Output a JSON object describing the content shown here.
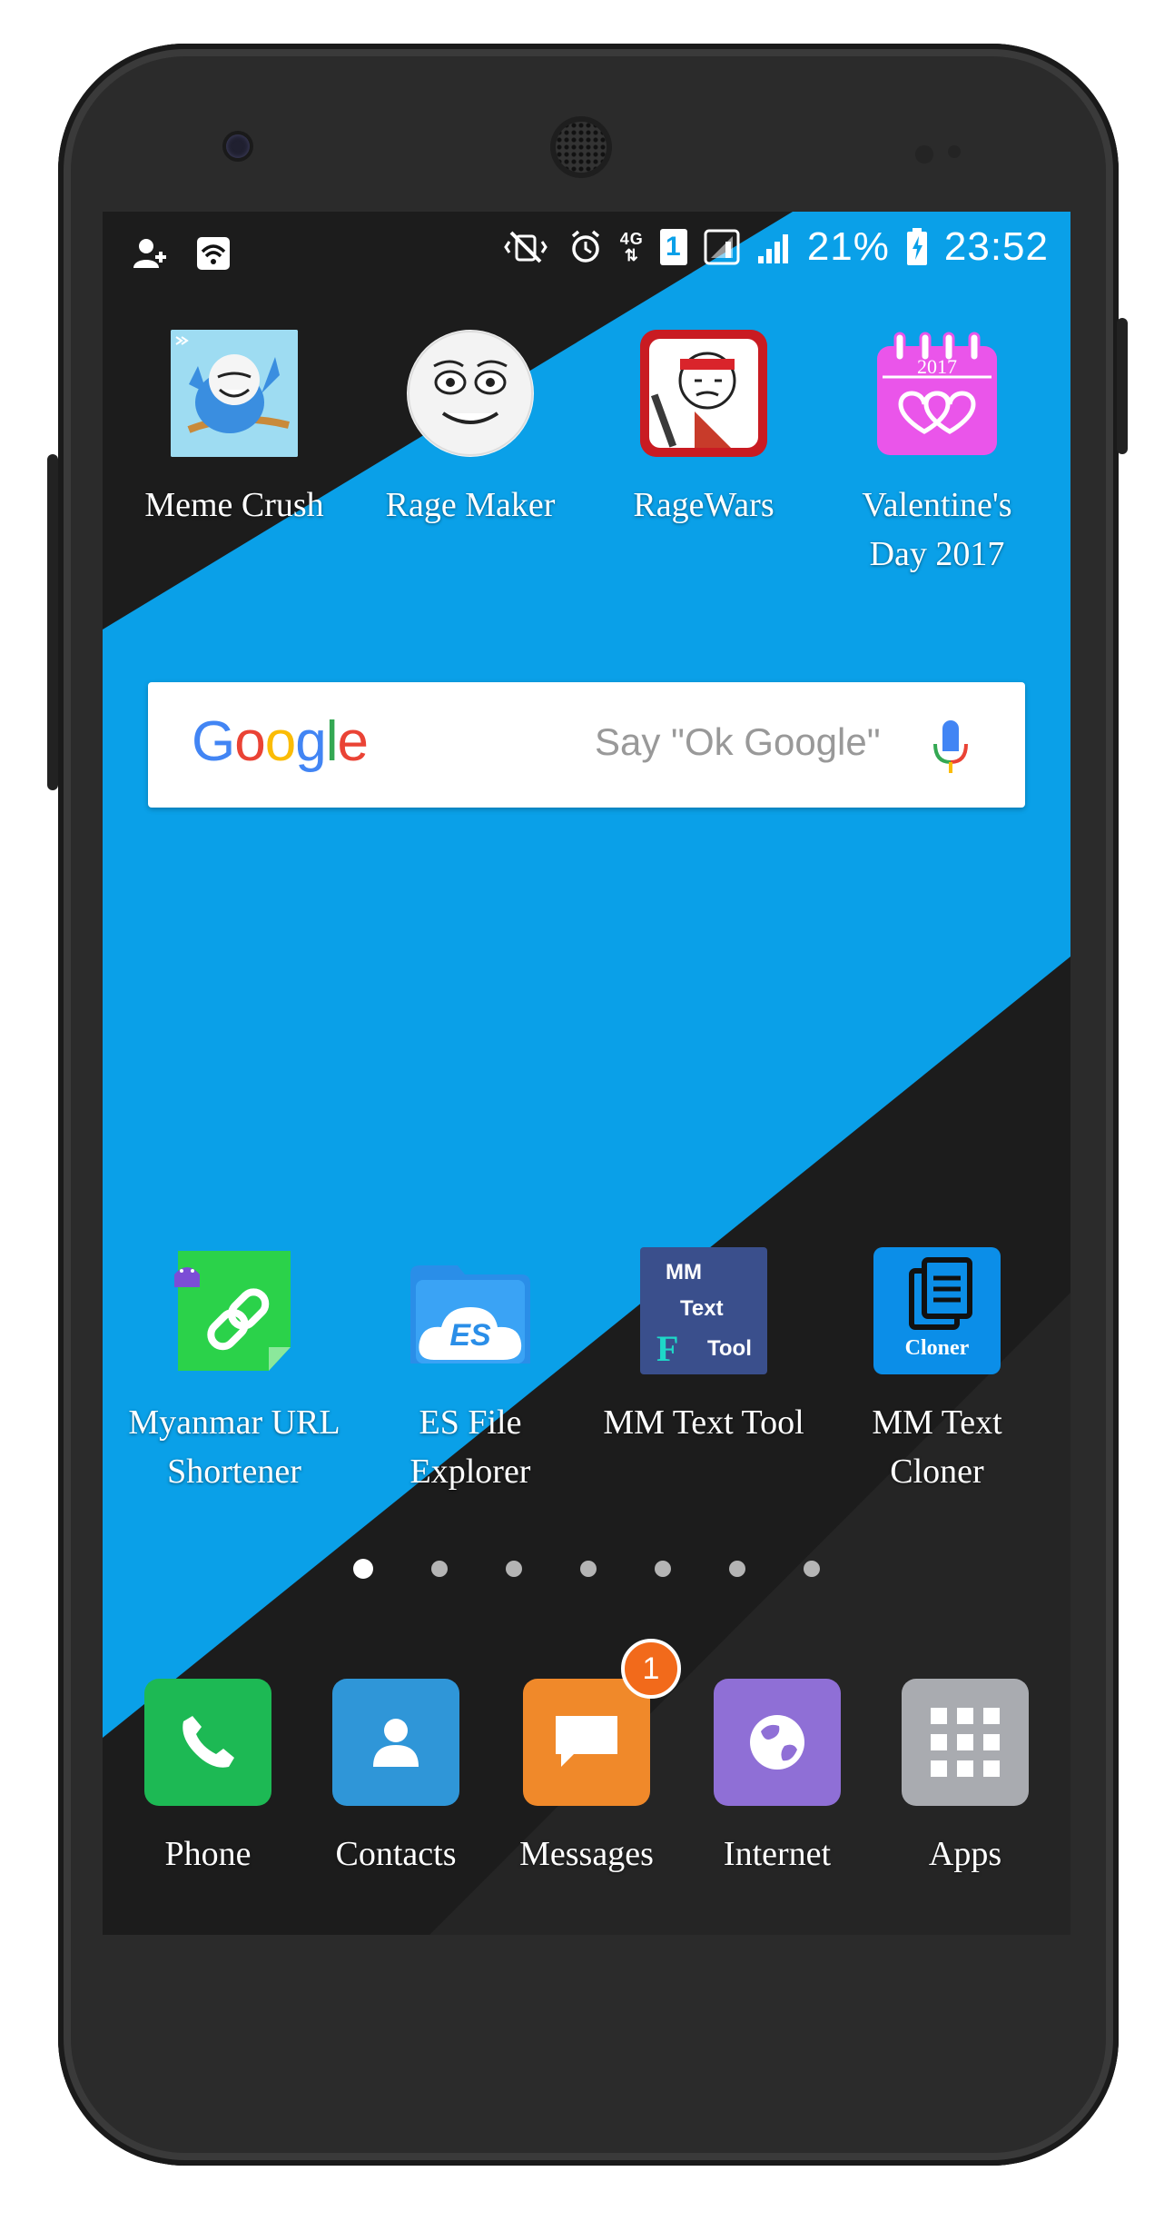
{
  "status_bar": {
    "battery": "21%",
    "time": "23:52",
    "network": "4G",
    "sim": "1"
  },
  "home_apps": [
    {
      "label": "Meme Crush",
      "icon": "meme-crush-icon"
    },
    {
      "label": "Rage Maker",
      "icon": "rage-maker-icon"
    },
    {
      "label": "RageWars",
      "icon": "ragewars-icon"
    },
    {
      "label": "Valentine's\nDay 2017",
      "icon": "valentine-calendar-icon",
      "year": "2017"
    },
    {
      "label": "Myanmar URL\nShortener",
      "icon": "link-icon"
    },
    {
      "label": "ES File\nExplorer",
      "icon": "es-cloud-icon",
      "glyph": "ES"
    },
    {
      "label": "MM Text Tool",
      "icon": "mm-text-tool-icon",
      "lines": [
        "MM",
        "Text",
        "F",
        "Tool"
      ]
    },
    {
      "label": "MM Text\nCloner",
      "icon": "document-copy-icon",
      "caption": "Cloner"
    }
  ],
  "google_bar": {
    "logo": "Google",
    "hint": "Say \"Ok Google\""
  },
  "pages": {
    "count": 7,
    "active": 0
  },
  "dock": [
    {
      "label": "Phone",
      "icon": "phone-icon",
      "color": "#1db954"
    },
    {
      "label": "Contacts",
      "icon": "contact-icon",
      "color": "#2f96d8"
    },
    {
      "label": "Messages",
      "icon": "message-icon",
      "color": "#f0892a",
      "badge": "1"
    },
    {
      "label": "Internet",
      "icon": "globe-icon",
      "color": "#8f6fd6"
    },
    {
      "label": "Apps",
      "icon": "grid-icon",
      "color": "#a9abb0"
    }
  ],
  "colors": {
    "wallpaper_blue": "#0aa0e8",
    "wallpaper_dark": "#1e1e1e",
    "badge": "#f26a1b"
  }
}
